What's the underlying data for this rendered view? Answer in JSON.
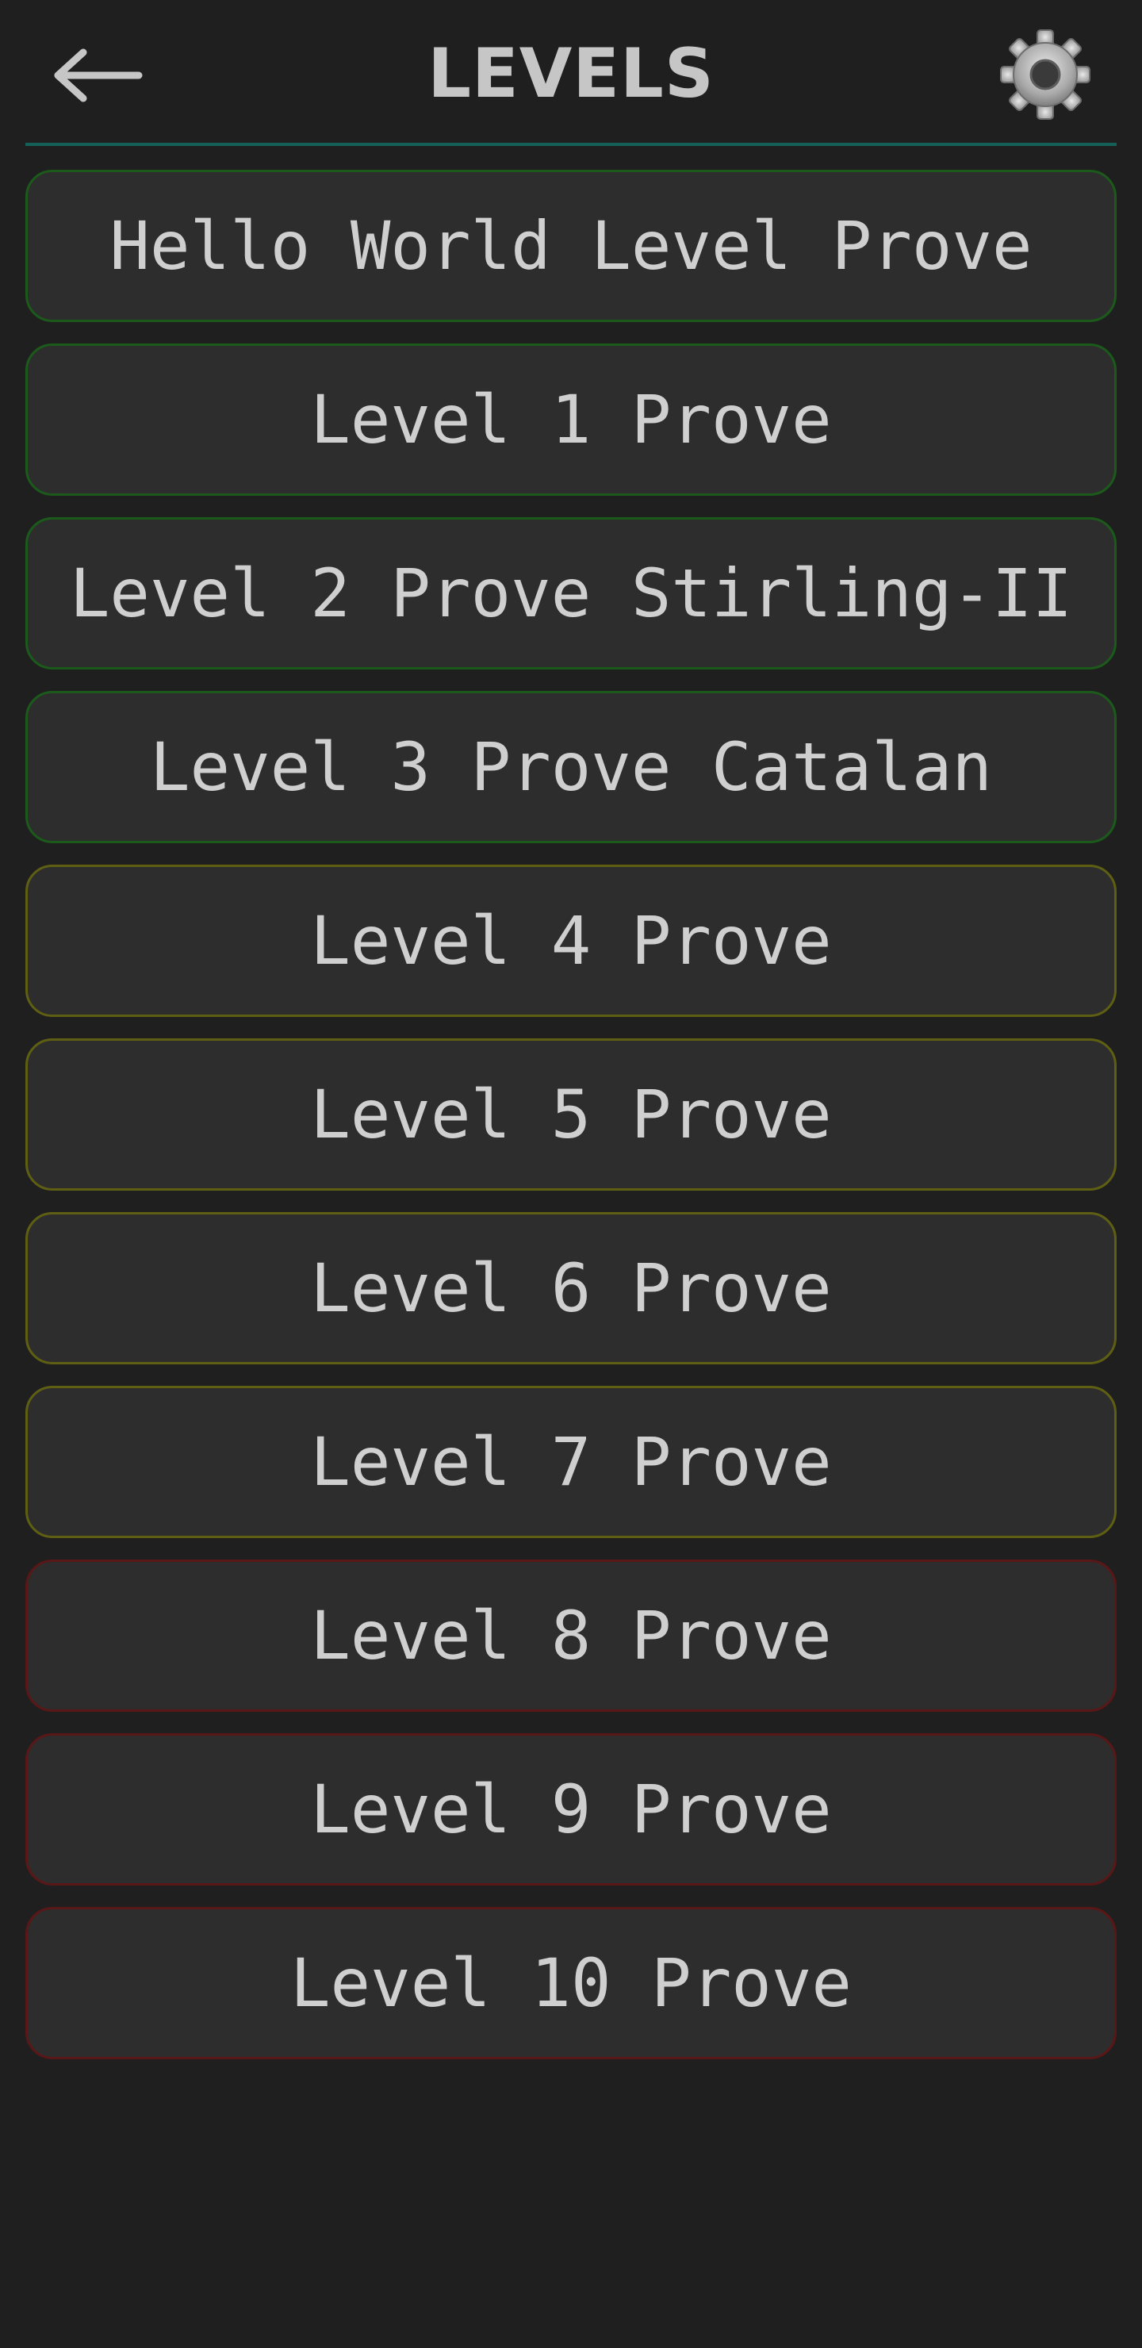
{
  "header": {
    "title": "LEVELS",
    "back_icon": "left-arrow-icon",
    "settings_icon": "gear-icon"
  },
  "colors": {
    "background": "#1f1f1f",
    "button_fill": "#2d2d2d",
    "divider": "#136159",
    "border_green": "#1c5a1c",
    "border_yellow": "#5e5f12",
    "border_red": "#5a1717"
  },
  "levels": [
    {
      "label": "Hello World Level Prove",
      "status": "green"
    },
    {
      "label": "Level 1 Prove",
      "status": "green"
    },
    {
      "label": "Level 2 Prove Stirling-II",
      "status": "green"
    },
    {
      "label": "Level 3 Prove Catalan",
      "status": "green"
    },
    {
      "label": "Level 4 Prove",
      "status": "yellow"
    },
    {
      "label": "Level 5 Prove",
      "status": "yellow"
    },
    {
      "label": "Level 6 Prove",
      "status": "yellow"
    },
    {
      "label": "Level 7 Prove",
      "status": "yellow"
    },
    {
      "label": "Level 8 Prove",
      "status": "red"
    },
    {
      "label": "Level 9 Prove",
      "status": "red"
    },
    {
      "label": "Level 10 Prove",
      "status": "red"
    }
  ]
}
